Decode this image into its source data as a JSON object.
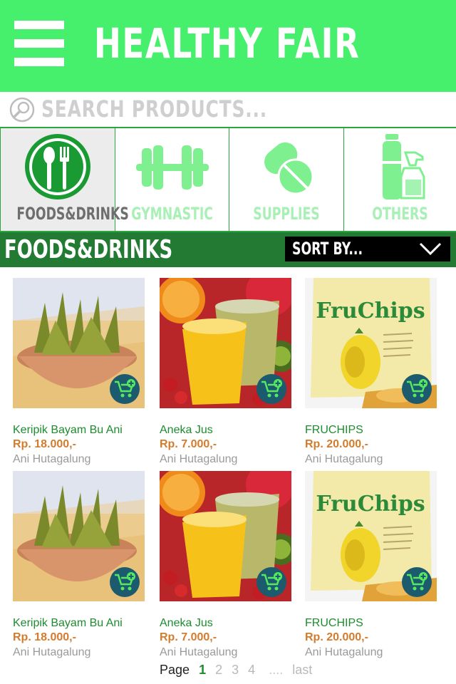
{
  "header": {
    "title": "Healthy Fair"
  },
  "search": {
    "placeholder": "Search products..."
  },
  "categories": [
    {
      "label": "Foods&Drinks",
      "icon": "fork-spoon-icon",
      "active": true
    },
    {
      "label": "Gymnastic",
      "icon": "dumbbell-icon",
      "active": false
    },
    {
      "label": "Supplies",
      "icon": "pills-icon",
      "active": false
    },
    {
      "label": "Others",
      "icon": "bottles-icon",
      "active": false
    }
  ],
  "section": {
    "title": "Foods&Drinks",
    "sort_label": "Sort by..."
  },
  "products": [
    {
      "name": "Keripik Bayam Bu Ani",
      "price": "Rp. 18.000,-",
      "seller": "Ani Hutagalung"
    },
    {
      "name": "Aneka Jus",
      "price": "Rp. 7.000,-",
      "seller": "Ani Hutagalung"
    },
    {
      "name": "FRUCHIPS",
      "price": "Rp. 20.000,-",
      "seller": "Ani Hutagalung"
    },
    {
      "name": "Keripik Bayam Bu Ani",
      "price": "Rp. 18.000,-",
      "seller": "Ani Hutagalung"
    },
    {
      "name": "Aneka Jus",
      "price": "Rp. 7.000,-",
      "seller": "Ani Hutagalung"
    },
    {
      "name": "FRUCHIPS",
      "price": "Rp. 20.000,-",
      "seller": "Ani Hutagalung"
    }
  ],
  "fruchips_brand": "FruChips",
  "pagination": {
    "label": "Page",
    "current": "1",
    "pages": [
      "2",
      "3",
      "4"
    ],
    "ellipsis": "....",
    "last": "last"
  },
  "colors": {
    "header": "#46f06c",
    "section_bar": "#237a33",
    "product_name": "#1d8c2e",
    "price": "#d47b2c",
    "seller": "#9a9a9a",
    "cart_button": "#1c5a6e"
  }
}
